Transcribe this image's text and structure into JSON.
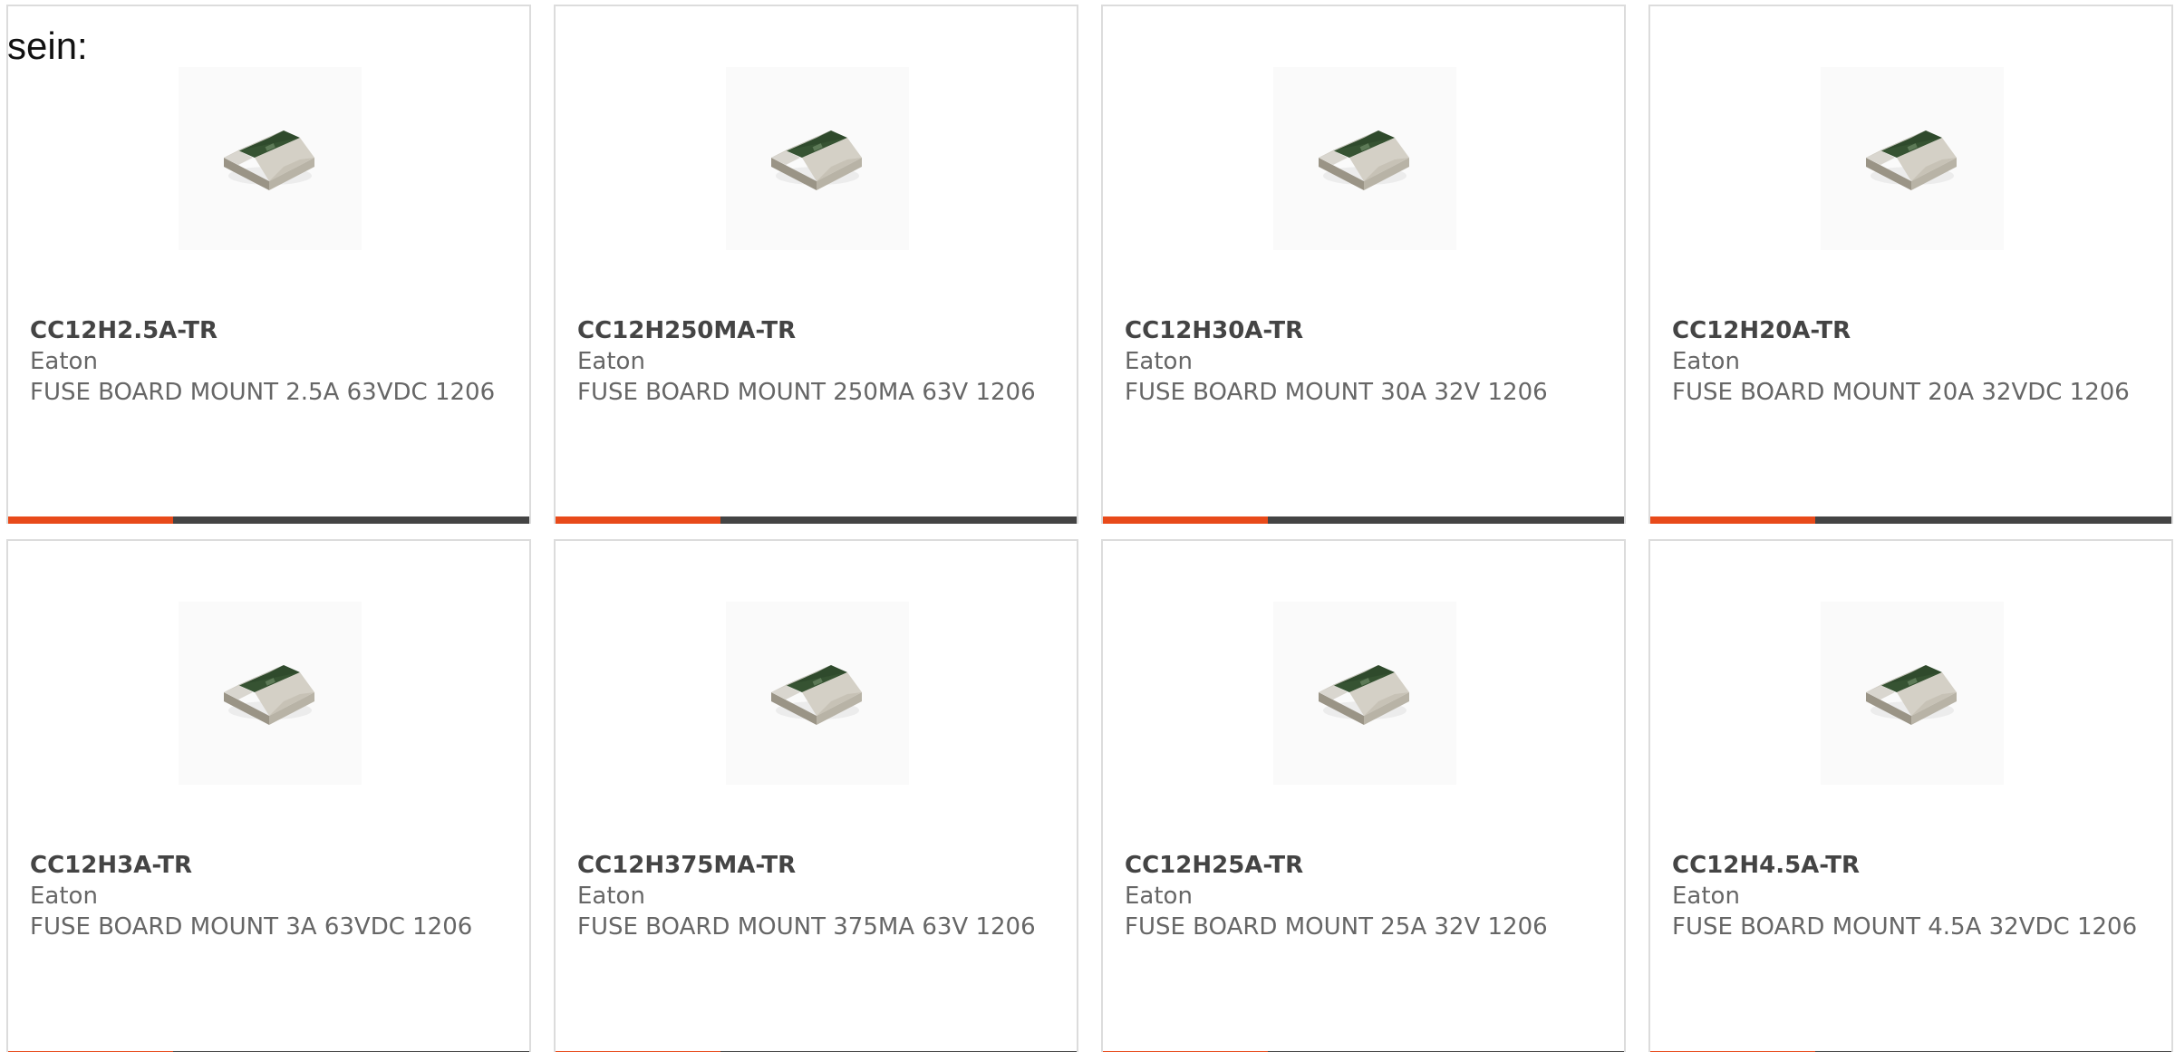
{
  "lead_text": "sein:",
  "colors": {
    "accent": "#e84a1a",
    "bar": "#444444",
    "card_border": "#dcdcdc",
    "part_number": "#444444",
    "text": "#666666"
  },
  "products": [
    {
      "part_number": "CC12H2.5A-TR",
      "manufacturer": "Eaton",
      "description": "FUSE BOARD MOUNT 2.5A 63VDC 1206",
      "image": "smd-fuse-1206"
    },
    {
      "part_number": "CC12H250MA-TR",
      "manufacturer": "Eaton",
      "description": "FUSE BOARD MOUNT 250MA 63V 1206",
      "image": "smd-fuse-1206"
    },
    {
      "part_number": "CC12H30A-TR",
      "manufacturer": "Eaton",
      "description": "FUSE BOARD MOUNT 30A 32V 1206",
      "image": "smd-fuse-1206"
    },
    {
      "part_number": "CC12H20A-TR",
      "manufacturer": "Eaton",
      "description": "FUSE BOARD MOUNT 20A 32VDC 1206",
      "image": "smd-fuse-1206"
    },
    {
      "part_number": "CC12H3A-TR",
      "manufacturer": "Eaton",
      "description": "FUSE BOARD MOUNT 3A 63VDC 1206",
      "image": "smd-fuse-1206"
    },
    {
      "part_number": "CC12H375MA-TR",
      "manufacturer": "Eaton",
      "description": "FUSE BOARD MOUNT 375MA 63V 1206",
      "image": "smd-fuse-1206"
    },
    {
      "part_number": "CC12H25A-TR",
      "manufacturer": "Eaton",
      "description": "FUSE BOARD MOUNT 25A 32V 1206",
      "image": "smd-fuse-1206"
    },
    {
      "part_number": "CC12H4.5A-TR",
      "manufacturer": "Eaton",
      "description": "FUSE BOARD MOUNT 4.5A 32VDC 1206",
      "image": "smd-fuse-1206"
    }
  ]
}
